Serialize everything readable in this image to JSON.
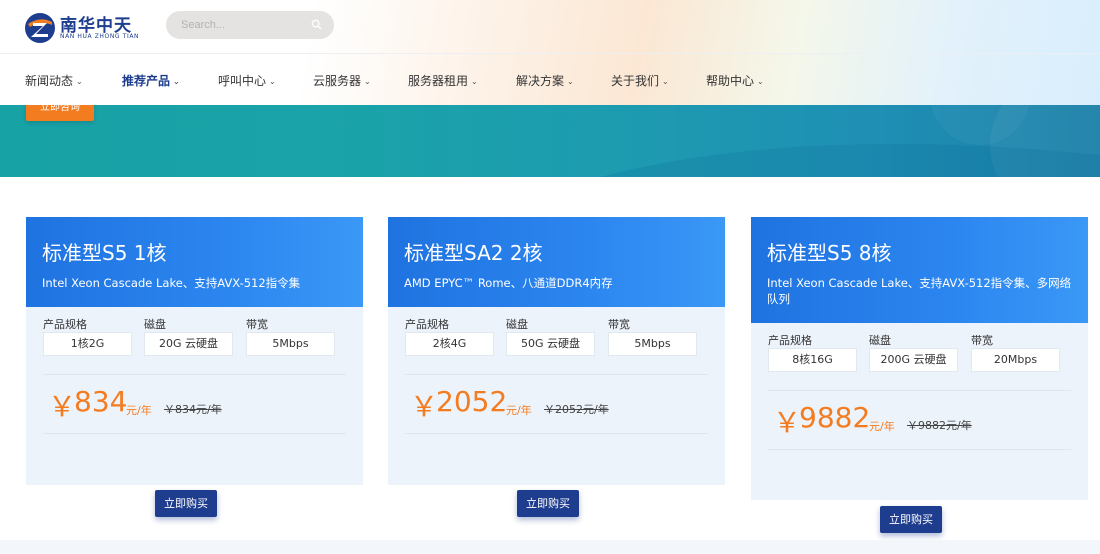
{
  "brand": {
    "name_cn": "南华中天",
    "name_en": "NAN HUA ZHONG TIAN"
  },
  "search": {
    "placeholder": "Search..."
  },
  "nav": {
    "items": [
      {
        "label": "新闻动态"
      },
      {
        "label": "推荐产品"
      },
      {
        "label": "呼叫中心"
      },
      {
        "label": "云服务器"
      },
      {
        "label": "服务器租用"
      },
      {
        "label": "解决方案"
      },
      {
        "label": "关于我们"
      },
      {
        "label": "帮助中心"
      }
    ],
    "active_index": 1
  },
  "banner": {
    "button_label": "立即咨询"
  },
  "cards": [
    {
      "title": "标准型S5 1核",
      "subtitle": "Intel Xeon Cascade Lake、支持AVX-512指令集",
      "spec_labels": [
        "产品规格",
        "磁盘",
        "带宽"
      ],
      "spec_values": [
        "1核2G",
        "20G 云硬盘",
        "5Mbps"
      ],
      "currency": "￥",
      "price": "834",
      "unit": "元/年",
      "original_price": "￥834元/年",
      "buy_label": "立即购买"
    },
    {
      "title": "标准型SA2 2核",
      "subtitle": "AMD EPYC™ Rome、八通道DDR4内存",
      "spec_labels": [
        "产品规格",
        "磁盘",
        "带宽"
      ],
      "spec_values": [
        "2核4G",
        "50G 云硬盘",
        "5Mbps"
      ],
      "currency": "￥",
      "price": "2052",
      "unit": "元/年",
      "original_price": "￥2052元/年",
      "buy_label": "立即购买"
    },
    {
      "title": "标准型S5 8核",
      "subtitle": "Intel Xeon Cascade Lake、支持AVX-512指令集、多网络队列",
      "spec_labels": [
        "产品规格",
        "磁盘",
        "带宽"
      ],
      "spec_values": [
        "8核16G",
        "200G 云硬盘",
        "20Mbps"
      ],
      "currency": "￥",
      "price": "9882",
      "unit": "元/年",
      "original_price": "￥9882元/年",
      "buy_label": "立即购买"
    }
  ],
  "colors": {
    "brand_navy": "#1d3d8f",
    "accent_orange": "#f47c20",
    "card_head_blue": "#2c86f0",
    "banner_teal": "#1aa3a8"
  }
}
